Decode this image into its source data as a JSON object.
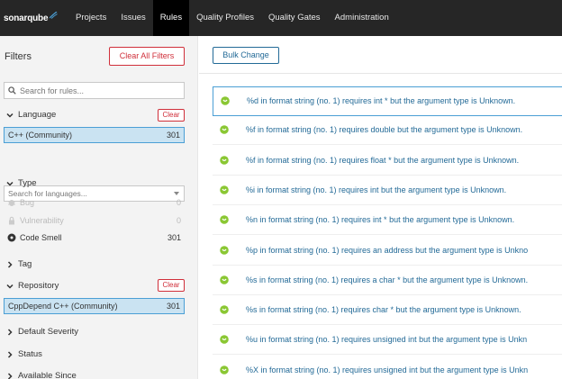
{
  "header": {
    "logo_text": "sonarqube",
    "nav": [
      "Projects",
      "Issues",
      "Rules",
      "Quality Profiles",
      "Quality Gates",
      "Administration"
    ],
    "active": "Rules"
  },
  "sidebar": {
    "filters_title": "Filters",
    "clear_all_label": "Clear All Filters",
    "search_placeholder": "Search for rules...",
    "language": {
      "label": "Language",
      "clear_label": "Clear",
      "selected": {
        "name": "C++ (Community)",
        "count": "301"
      },
      "search_placeholder": "Search for languages..."
    },
    "type": {
      "label": "Type",
      "items": [
        {
          "name": "Bug",
          "count": "0",
          "icon": "bug-icon"
        },
        {
          "name": "Vulnerability",
          "count": "0",
          "icon": "lock-icon"
        },
        {
          "name": "Code Smell",
          "count": "301",
          "icon": "code-smell-icon"
        }
      ]
    },
    "tag": {
      "label": "Tag"
    },
    "repository": {
      "label": "Repository",
      "clear_label": "Clear",
      "selected": {
        "name": "CppDepend C++ (Community)",
        "count": "301"
      }
    },
    "default_severity": {
      "label": "Default Severity"
    },
    "status": {
      "label": "Status"
    },
    "available_since": {
      "label": "Available Since"
    }
  },
  "main": {
    "bulk_change_label": "Bulk Change",
    "rules": [
      "%d in format string (no. 1) requires int * but the argument type is Unknown.",
      "%f in format string (no. 1) requires double but the argument type is Unknown.",
      "%f in format string (no. 1) requires float * but the argument type is Unknown.",
      "%i in format string (no. 1) requires int but the argument type is Unknown.",
      "%n in format string (no. 1) requires int * but the argument type is Unknown.",
      "%p in format string (no. 1) requires an address but the argument type is Unkno",
      "%s in format string (no. 1) requires a char * but the argument type is Unknown.",
      "%s in format string (no. 1) requires char * but the argument type is Unknown.",
      "%u in format string (no. 1) requires unsigned int but the argument type is Unkn",
      "%X in format string (no. 1) requires unsigned int but the argument type is Unkn"
    ]
  },
  "colors": {
    "topbar": "#262626",
    "active_tab": "#000000",
    "link_blue": "#236a97",
    "selected_bg": "#cae3f2",
    "clear_red": "#d02f3a",
    "smell_green": "#8ac733"
  }
}
